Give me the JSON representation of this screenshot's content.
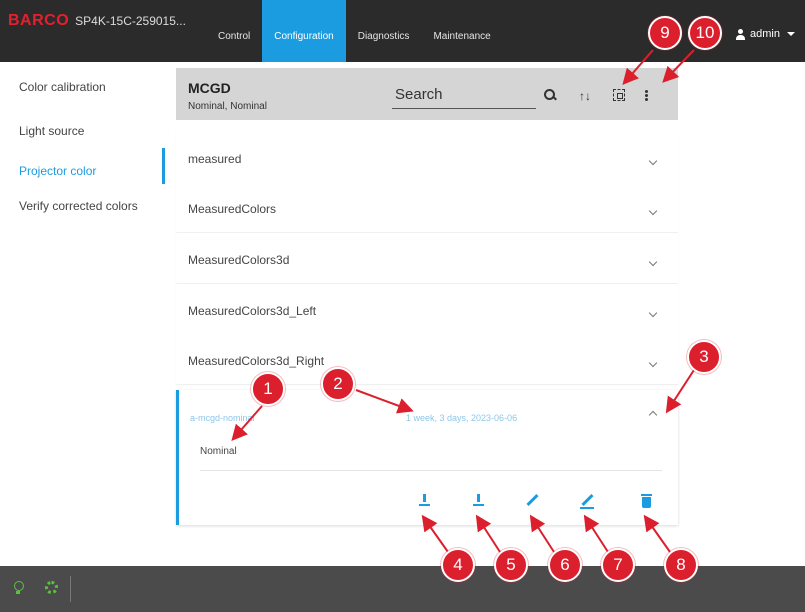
{
  "topbar": {
    "logo": "BARCO",
    "device": "SP4K-15C-259015...",
    "tabs": [
      {
        "label": "Control",
        "active": false
      },
      {
        "label": "Configuration",
        "active": true
      },
      {
        "label": "Diagnostics",
        "active": false
      },
      {
        "label": "Maintenance",
        "active": false
      }
    ],
    "user": "admin"
  },
  "sidebar": {
    "items": [
      {
        "label": "Color calibration",
        "active": false
      },
      {
        "label": "Light source",
        "active": false
      },
      {
        "label": "Projector color",
        "active": true
      },
      {
        "label": "Verify corrected colors",
        "active": false
      }
    ]
  },
  "panel": {
    "title": "MCGD",
    "subtitle": "Nominal, Nominal",
    "search_label": "Search",
    "sort_icon": "↑↓",
    "rows": [
      {
        "label": "measured"
      },
      {
        "label": "MeasuredColors"
      },
      {
        "label": "MeasuredColors3d"
      },
      {
        "label": "MeasuredColors3d_Left"
      },
      {
        "label": "MeasuredColors3d_Right"
      }
    ],
    "expanded": {
      "name": "a-mcgd-nominal",
      "date": "1 week, 3 days, 2023-06-06",
      "label": "Nominal"
    }
  },
  "callouts": [
    "1",
    "2",
    "3",
    "4",
    "5",
    "6",
    "7",
    "8",
    "9",
    "10"
  ],
  "colors": {
    "accent": "#1b9ce0",
    "callout": "#dc1f2d",
    "status_ok": "#57c43c",
    "topbar_bg": "#2b2b2b"
  }
}
